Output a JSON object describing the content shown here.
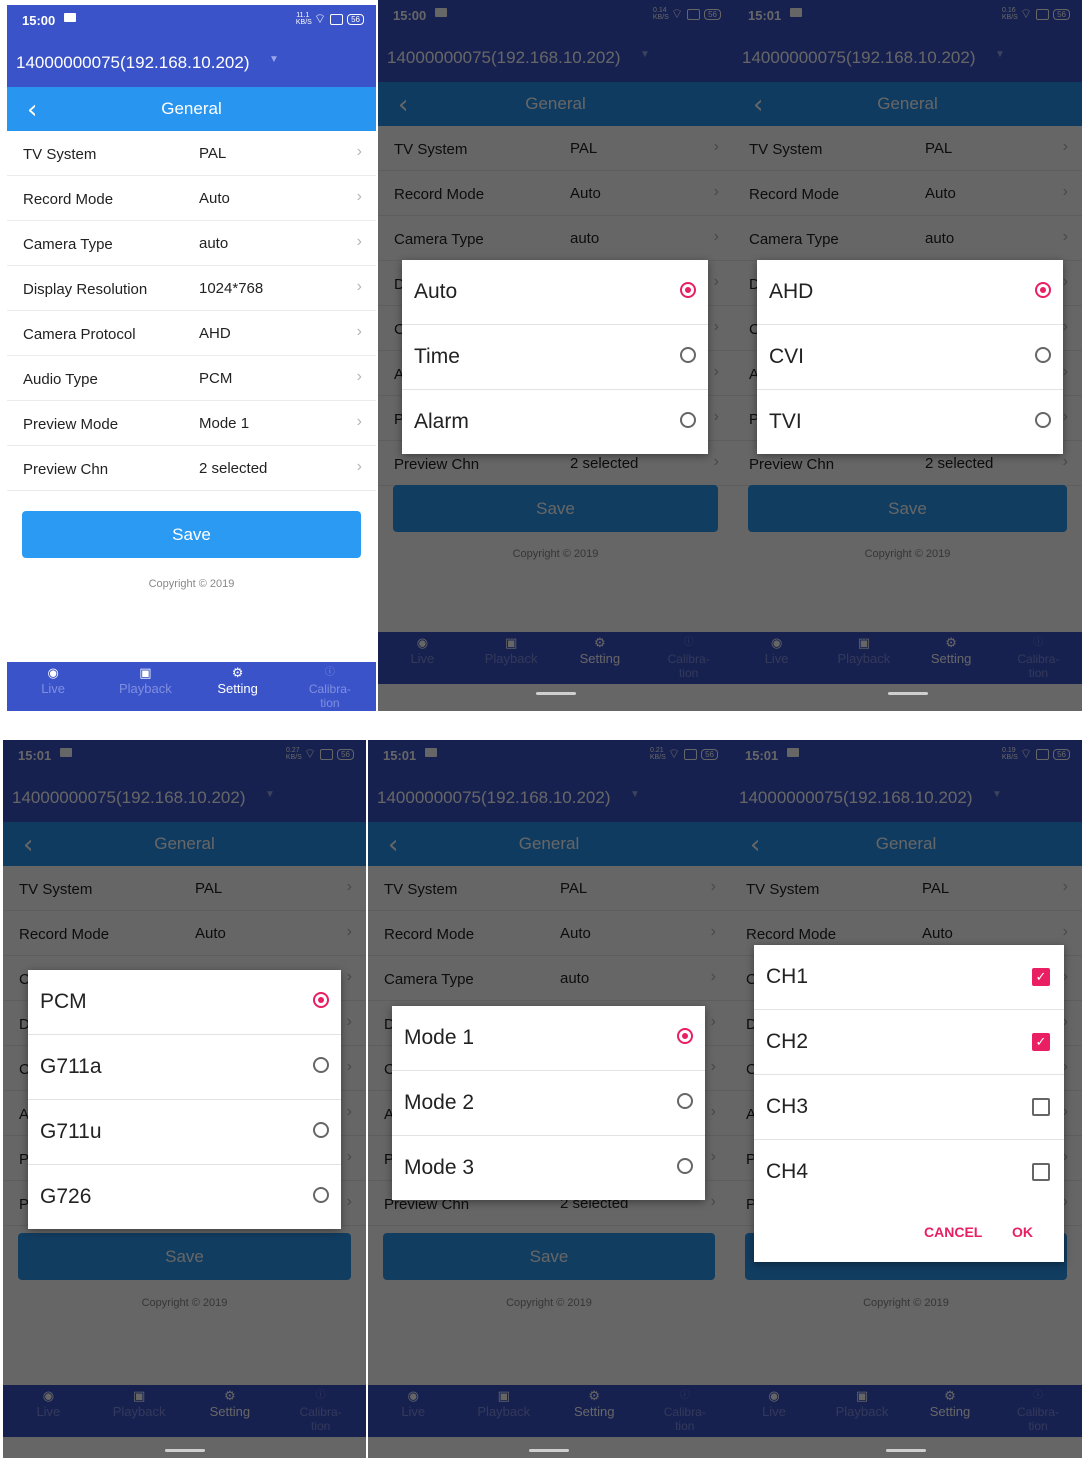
{
  "common": {
    "device": "14000000075(192.168.10.202)",
    "screen_title": "General",
    "save_label": "Save",
    "copyright": "Copyright © 2019",
    "tabs": {
      "live": "Live",
      "playback": "Playback",
      "setting": "Setting",
      "calibration": "Calibra-\ntion"
    },
    "settings": [
      {
        "label": "TV System",
        "value": "PAL"
      },
      {
        "label": "Record Mode",
        "value": "Auto"
      },
      {
        "label": "Camera Type",
        "value": "auto"
      },
      {
        "label": "Display Resolution",
        "value": "1024*768"
      },
      {
        "label": "Camera Protocol",
        "value": "AHD"
      },
      {
        "label": "Audio Type",
        "value": "PCM"
      },
      {
        "label": "Preview Mode",
        "value": "Mode 1"
      },
      {
        "label": "Preview Chn",
        "value": "2 selected"
      }
    ],
    "battery": "56",
    "colors": {
      "header": "#3b53c9",
      "titlebar": "#2895f0",
      "accent": "#e91e63",
      "save": "#2b9af3"
    }
  },
  "screens": [
    {
      "time": "15:00",
      "net": "11.1 KB/S",
      "dialog": null
    },
    {
      "time": "15:00",
      "net": "0.14 KB/S",
      "dialog": {
        "type": "radio",
        "options": [
          "Auto",
          "Time",
          "Alarm"
        ],
        "selected": 0
      }
    },
    {
      "time": "15:01",
      "net": "0.16 KB/S",
      "dialog": {
        "type": "radio",
        "options": [
          "AHD",
          "CVI",
          "TVI"
        ],
        "selected": 0
      }
    },
    {
      "time": "15:01",
      "net": "0.27 KB/S",
      "dialog": {
        "type": "radio",
        "options": [
          "PCM",
          "G711a",
          "G711u",
          "G726"
        ],
        "selected": 0
      }
    },
    {
      "time": "15:01",
      "net": "0.21 KB/S",
      "dialog": {
        "type": "radio",
        "options": [
          "Mode 1",
          "Mode 2",
          "Mode 3"
        ],
        "selected": 0
      }
    },
    {
      "time": "15:01",
      "net": "0.19 KB/S",
      "dialog": {
        "type": "check",
        "options": [
          "CH1",
          "CH2",
          "CH3",
          "CH4"
        ],
        "checked": [
          true,
          true,
          false,
          false
        ],
        "cancel": "CANCEL",
        "ok": "OK"
      }
    }
  ]
}
